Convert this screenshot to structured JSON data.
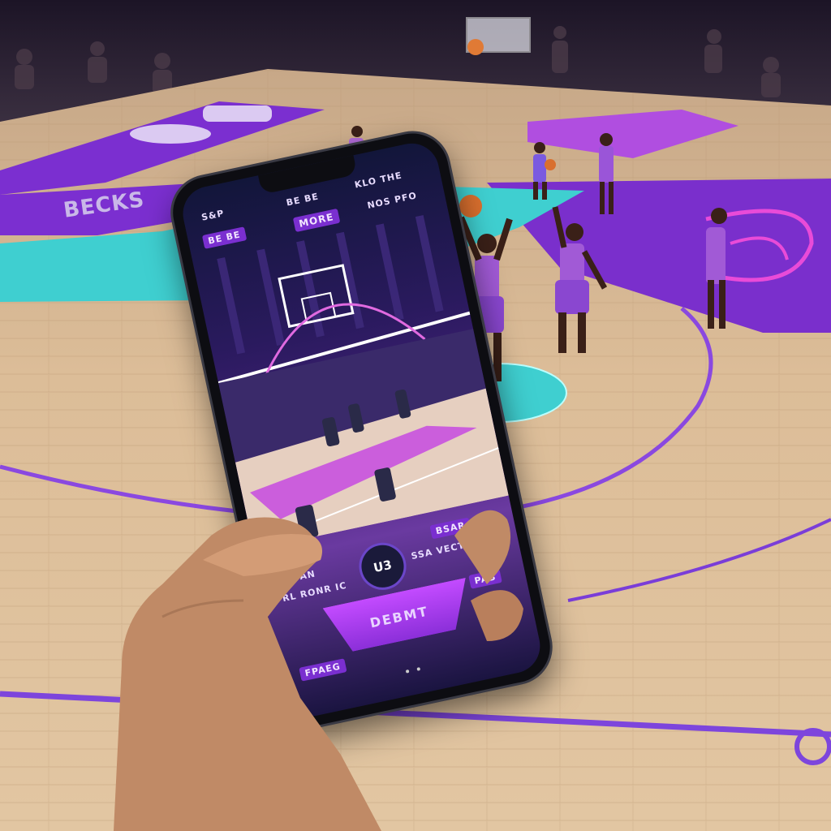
{
  "scene": {
    "court_labels": [
      "BECKS"
    ],
    "colors": {
      "floor": "#d8b88e",
      "purple": "#7b2fd0",
      "teal": "#3fcfd0",
      "magenta": "#d33ad9"
    }
  },
  "phone_screen": {
    "status": {
      "left": "S&P",
      "center": "BE BE",
      "right": "KLO THE"
    },
    "header": {
      "left_tag": "BE BE",
      "center_tag": "MORE",
      "right_text": "NOS PFO"
    },
    "hud": {
      "score_badge": "U3",
      "top_right": "BSAR",
      "left_row1": "ZESAN",
      "left_row2": "RL RONR IC",
      "right_row": "SSA VECTEM",
      "main_button": "DEBMT",
      "side_tag": "PAB",
      "bottom_tag": "FPAEG"
    }
  }
}
